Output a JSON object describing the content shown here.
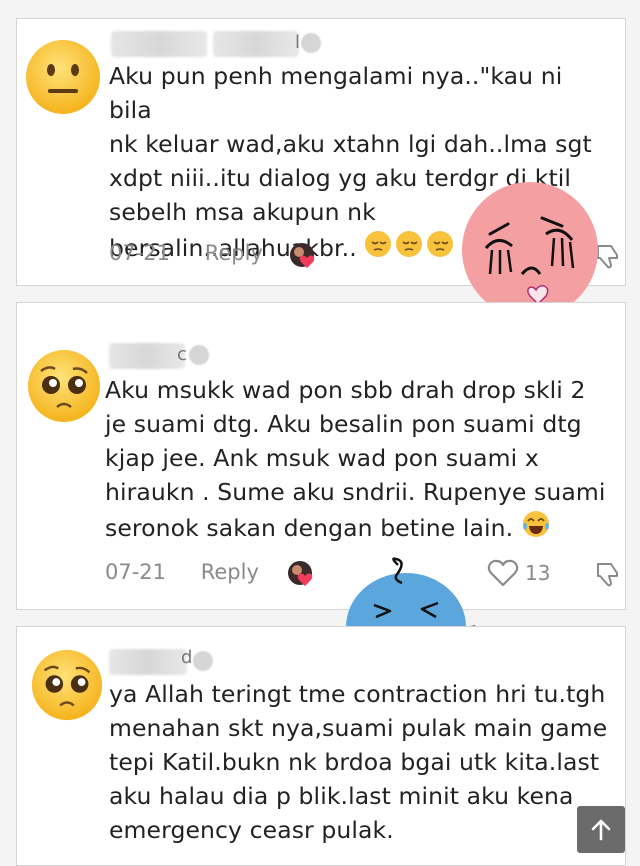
{
  "comments": [
    {
      "username_tail": "l",
      "text_lines": [
        "Aku pun penh mengalami nya..\"kau ni bila",
        "nk keluar wad,aku xtahn lgi dah..lma sgt",
        "xdpt niii..itu dialog yg aku terdgr di ktil",
        "sebelh msa akupun nk",
        "bersalin..allahuakbr.."
      ],
      "date": "07-21",
      "reply_label": "Reply",
      "avatar_emoji": "neutral-face",
      "trailing_emoji": "pensive-face"
    },
    {
      "username_tail": "c",
      "text_lines": [
        "Aku msukk wad pon sbb drah drop skli 2",
        "je suami dtg. Aku besalin pon suami dtg",
        "kjap jee. Ank msuk wad pon suami x",
        "hiraukn . Sume aku sndrii. Rupenye suami",
        "seronok sakan dengan betine lain."
      ],
      "date": "07-21",
      "reply_label": "Reply",
      "like_count": "13",
      "avatar_emoji": "pleading-face",
      "trailing_emoji": "tears-of-joy-face"
    },
    {
      "username_tail": "d",
      "text_lines": [
        "ya Allah teringt tme contraction hri tu.tgh",
        "menahan skt nya,suami pulak main game",
        "tepi Katil.bukn nk brdoa bgai utk kita.last",
        "aku halau dia p blik.last minit aku kena",
        "emergency ceasr pulak."
      ],
      "avatar_emoji": "pleading-face"
    }
  ],
  "icons": {
    "heart": "heart-outline-icon",
    "dislike": "thumbs-down-icon",
    "scroll_top": "arrow-up-icon"
  },
  "colors": {
    "pink_sticker": "#f4a0a2",
    "blue_sticker": "#5ba6dc",
    "meta_text": "#8a8a8a"
  }
}
